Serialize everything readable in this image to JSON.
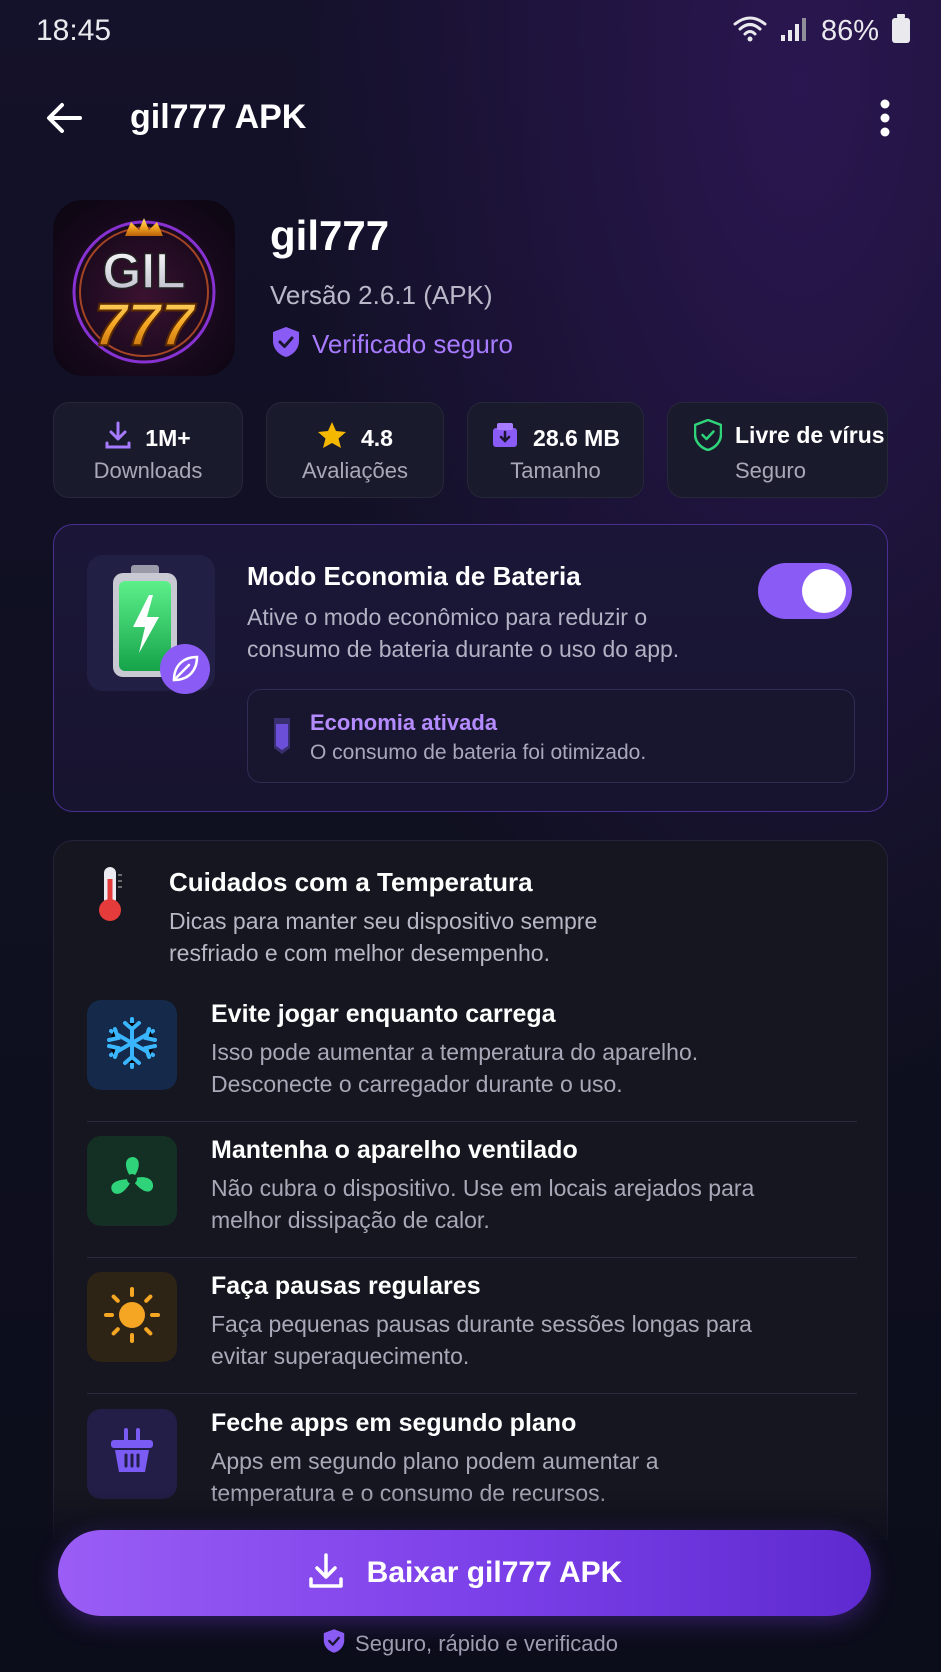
{
  "status_bar": {
    "time": "18:45",
    "battery_pct": "86%"
  },
  "app_bar": {
    "title": "gil777 APK"
  },
  "app": {
    "icon_text_top": "GIL",
    "icon_text_bottom": "777",
    "name": "gil777",
    "version": "Versão 2.6.1 (APK)",
    "verified_label": "Verificado seguro"
  },
  "stats": [
    {
      "value": "1M+",
      "label": "Downloads",
      "icon": "download-icon"
    },
    {
      "value": "4.8",
      "label": "Avaliações",
      "icon": "star-icon"
    },
    {
      "value": "28.6 MB",
      "label": "Tamanho",
      "icon": "package-icon"
    },
    {
      "value": "Livre de vírus",
      "label": "Seguro",
      "icon": "shield-check-icon"
    }
  ],
  "battery": {
    "title": "Modo Economia de Bateria",
    "description": "Ative o modo econômico para reduzir o consumo de bateria durante o uso do app.",
    "toggle_on": true,
    "status_title": "Economia ativada",
    "status_subtitle": "O consumo de bateria foi otimizado."
  },
  "temperature": {
    "title": "Cuidados com a Temperatura",
    "description": "Dicas para manter seu dispositivo sempre resfriado e com melhor desempenho.",
    "tips": [
      {
        "icon": "snowflake-icon",
        "title": "Evite jogar enquanto carrega",
        "description": "Isso pode aumentar a temperatura do aparelho. Desconecte o carregador durante o uso."
      },
      {
        "icon": "fan-icon",
        "title": "Mantenha o aparelho ventilado",
        "description": "Não cubra o dispositivo. Use em locais arejados para melhor dissipação de calor."
      },
      {
        "icon": "sun-icon",
        "title": "Faça pausas regulares",
        "description": "Faça pequenas pausas durante sessões longas para evitar superaquecimento."
      },
      {
        "icon": "basket-icon",
        "title": "Feche apps em segundo plano",
        "description": "Apps em segundo plano podem aumentar a temperatura e o consumo de recursos."
      }
    ]
  },
  "cta": {
    "label": "Baixar gil777 APK"
  },
  "footer": {
    "note": "Seguro, rápido e verificado"
  },
  "colors": {
    "accent": "#8a5cf5",
    "verified": "#a77bff",
    "background": "#0f1020"
  }
}
